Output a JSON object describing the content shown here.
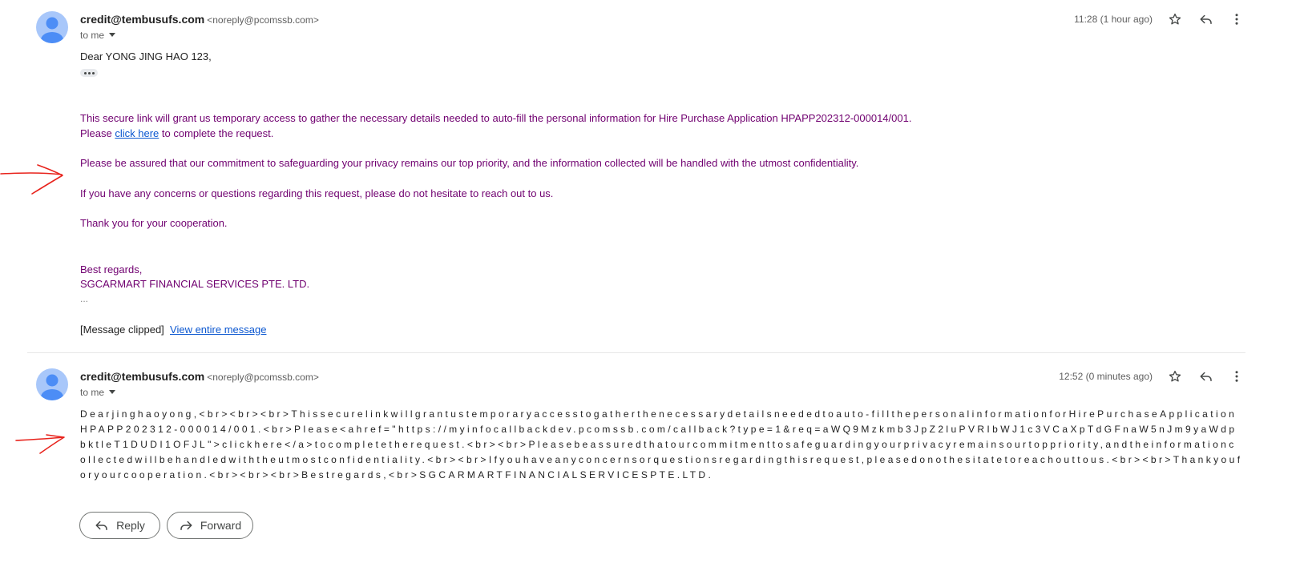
{
  "messages": [
    {
      "sender_name": "credit@tembusufs.com",
      "sender_email": "<noreply@pcomssb.com>",
      "to_label": "to me",
      "timestamp": "11:28 (1 hour ago)",
      "greeting": "Dear YONG JING HAO 123,",
      "body_line1": "This secure link will grant us temporary access to gather the necessary details needed to auto-fill the personal information for Hire Purchase Application HPAPP202312-000014/001.",
      "body_line2_prefix": "Please ",
      "body_link": "click here",
      "body_line2_suffix": " to complete the request.",
      "body_line3": "Please be assured that our commitment to safeguarding your privacy remains our top priority, and the information collected will be handled with the utmost confidentiality.",
      "body_line4": "If you have any concerns or questions regarding this request, please do not hesitate to reach out to us.",
      "body_line5": "Thank you for your cooperation.",
      "signoff": "Best regards,",
      "company": "SGCARMART FINANCIAL SERVICES PTE. LTD.",
      "trailing_dots": "...",
      "clipped_label": "[Message clipped]",
      "view_entire_label": "View entire message"
    },
    {
      "sender_name": "credit@tembusufs.com",
      "sender_email": "<noreply@pcomssb.com>",
      "to_label": "to me",
      "timestamp": "12:52 (0 minutes ago)",
      "raw_body": "Dearjinghaoyong,<br><br><br>Thissecurelinkwillgrantustemporaryaccesstogatherthenecessarydetailsneededtoauto-fillthepersonalinformationforHirePurchaseApplicationHPAPP202312-000014/001.<br>Please<ahref=\"https://myinfocallbackdev.pcomssb.com/callback?type=1&req=aWQ9Mzkmb3JpZ2luPVRIbWJ1c3VCaXpTdGFnaW5nJm9yaWdpbktleT1DUDI1OFJL\">clickhere</a>tocompletetherequest.<br><br>Pleasebeassuredthatourcommitmenttosafeguardingyourprivacyremainsourtoppriority,andtheinformationcollectedwillbehandledwiththeutmostconfidentiality.<br><br>Ifyouhaveanyconcernsorquestionsregardingthisrequest,pleasedonothesitatetoreachouttous.<br><br>Thankyouforyourcooperation.<br><br><br>Bestregards,<br>SGCARMARTFINANCIALSERVICESPTE.LTD."
    }
  ],
  "actions": {
    "reply_label": "Reply",
    "forward_label": "Forward"
  },
  "icons": {
    "star": "star-icon",
    "reply": "reply-icon",
    "more": "more-vert-icon",
    "avatar": "person-avatar",
    "annotation": "red-arrow-annotation"
  },
  "colors": {
    "body_text": "#700070",
    "link": "#0b57d0",
    "avatar_bg": "#a8c7fa",
    "avatar_fg": "#4c8df6",
    "annotation": "#e8231c"
  }
}
